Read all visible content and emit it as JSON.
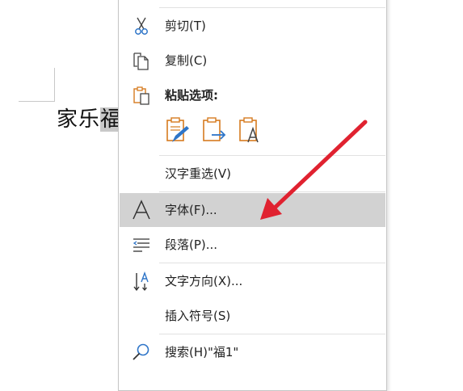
{
  "document": {
    "text_before": "家乐",
    "text_selected": "福"
  },
  "menu": {
    "items": {
      "cut": "剪切(T)",
      "copy": "复制(C)",
      "paste_header": "粘贴选项:",
      "reconvert": "汉字重选(V)",
      "font": "字体(F)...",
      "paragraph": "段落(P)...",
      "text_direction": "文字方向(X)...",
      "insert_symbol": "插入符号(S)",
      "search": "搜索(H)\"福1\""
    },
    "icons": {
      "cut": "scissors-icon",
      "copy": "copy-icon",
      "paste": "paste-icon",
      "paste_keep_format": "paste-keep-format-icon",
      "paste_merge": "paste-merge-format-icon",
      "paste_text_only": "paste-text-only-icon",
      "font": "font-icon",
      "paragraph": "paragraph-icon",
      "text_direction": "text-direction-icon",
      "search": "search-icon"
    },
    "highlighted_item": "font"
  },
  "colors": {
    "accent_orange": "#d67b1f",
    "accent_blue": "#2e75c8",
    "annotation_arrow": "#e02230",
    "highlight": "#d2d2d2"
  }
}
